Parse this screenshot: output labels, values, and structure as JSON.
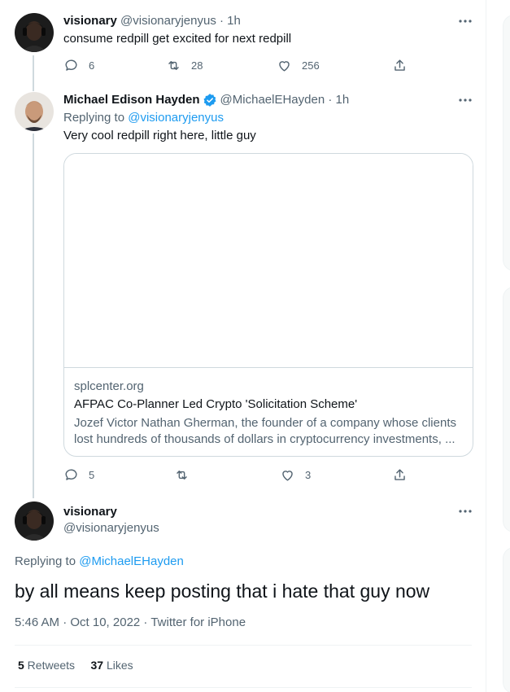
{
  "tweets": [
    {
      "display_name": "visionary",
      "handle": "@visionaryjenyus",
      "separator": "·",
      "time": "1h",
      "text": "consume redpill get excited for next redpill",
      "replies": "6",
      "retweets": "28",
      "likes": "256"
    },
    {
      "display_name": "Michael Edison Hayden",
      "verified": true,
      "handle": "@MichaelEHayden",
      "separator": "·",
      "time": "1h",
      "replying_prefix": "Replying to ",
      "replying_to": "@visionaryjenyus",
      "text": "Very cool redpill right here, little guy",
      "card": {
        "domain": "splcenter.org",
        "title": "AFPAC Co-Planner Led Crypto 'Solicitation Scheme'",
        "description_line1": "Jozef Victor Nathan Gherman, the founder of a company whose clients",
        "description_line2": "lost hundreds of thousands of dollars in cryptocurrency investments, ..."
      },
      "replies": "5",
      "retweets": "",
      "likes": "3"
    }
  ],
  "focused": {
    "display_name": "visionary",
    "handle": "@visionaryjenyus",
    "replying_prefix": "Replying to ",
    "replying_to": "@MichaelEHayden",
    "text": "by all means keep posting that i hate that guy now",
    "meta": "5:46 AM · Oct 10, 2022 · Twitter for iPhone",
    "retweets_count": "5",
    "retweets_label": " Retweets",
    "likes_count": "37",
    "likes_label": " Likes"
  },
  "icons": {
    "reply": "reply-icon",
    "retweet": "retweet-icon",
    "like": "heart-icon",
    "share": "share-icon",
    "more": "more-icon",
    "verified": "verified-badge-icon"
  },
  "colors": {
    "link": "#1d9bf0",
    "secondary_text": "#536471",
    "primary_text": "#0f1419",
    "border": "#cfd9de"
  }
}
